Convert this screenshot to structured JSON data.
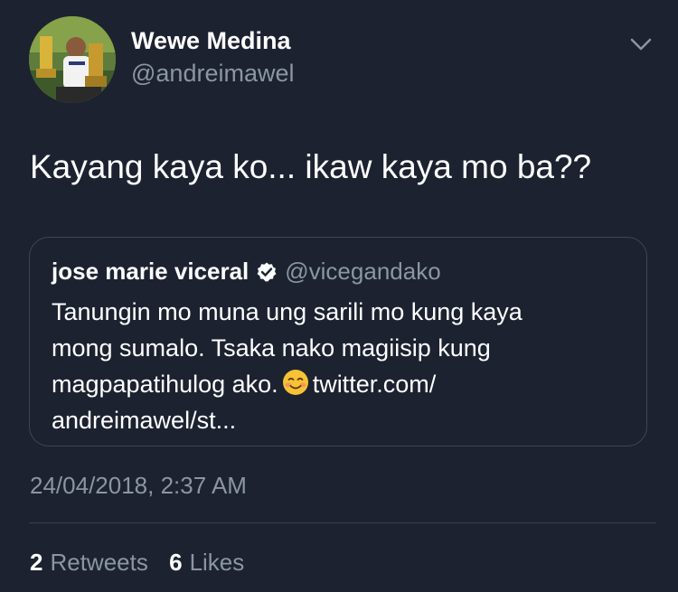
{
  "author": {
    "display_name": "Wewe Medina",
    "handle": "@andreimawel",
    "avatar_icon": "profile-photo"
  },
  "tweet": {
    "text": "Kayang kaya ko... ikaw kaya mo ba??",
    "timestamp": "24/04/2018, 2:37 AM"
  },
  "quoted_tweet": {
    "display_name": "jose marie viceral",
    "verified": true,
    "handle": "@vicegandako",
    "lines": [
      "Tanungin mo muna ung sarili mo kung kaya",
      "mong sumalo. Tsaka nako magiisip kung",
      "magpapatihulog ako.",
      "twitter.com/",
      "andreimawel/st..."
    ],
    "emoji": "smiling-face-emoji"
  },
  "stats": {
    "retweets_count": "2",
    "retweets_label": "Retweets",
    "likes_count": "6",
    "likes_label": "Likes"
  },
  "colors": {
    "background": "#1c2230",
    "secondary_text": "#8a96a3",
    "border": "#3d4756"
  }
}
